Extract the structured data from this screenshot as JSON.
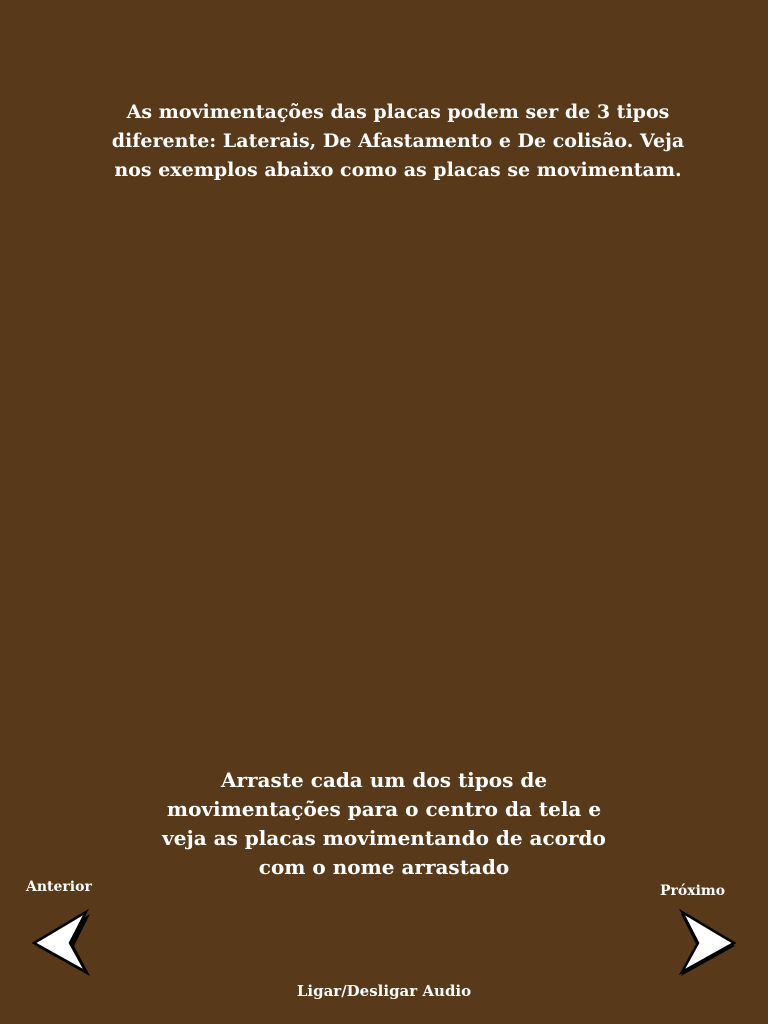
{
  "intro": {
    "text": "As movimentações das placas podem ser de 3 tipos diferente: Laterais, De Afastamento e De colisão. Veja nos exemplos abaixo como as placas se movimentam."
  },
  "instruction": {
    "text": "Arraste cada um dos tipos de movimentações para o centro da tela e veja as placas movimentando de acordo com o nome arrastado"
  },
  "navigation": {
    "previous_label": "Anterior",
    "next_label": "Próximo",
    "previous_icon": "arrow-left-icon",
    "next_icon": "arrow-right-icon"
  },
  "audio": {
    "toggle_label": "Ligar/Desligar Audio"
  },
  "colors": {
    "background": "#583a1b",
    "text": "#ffffff",
    "arrow_fill": "#ffffff",
    "arrow_outline": "#000000"
  }
}
